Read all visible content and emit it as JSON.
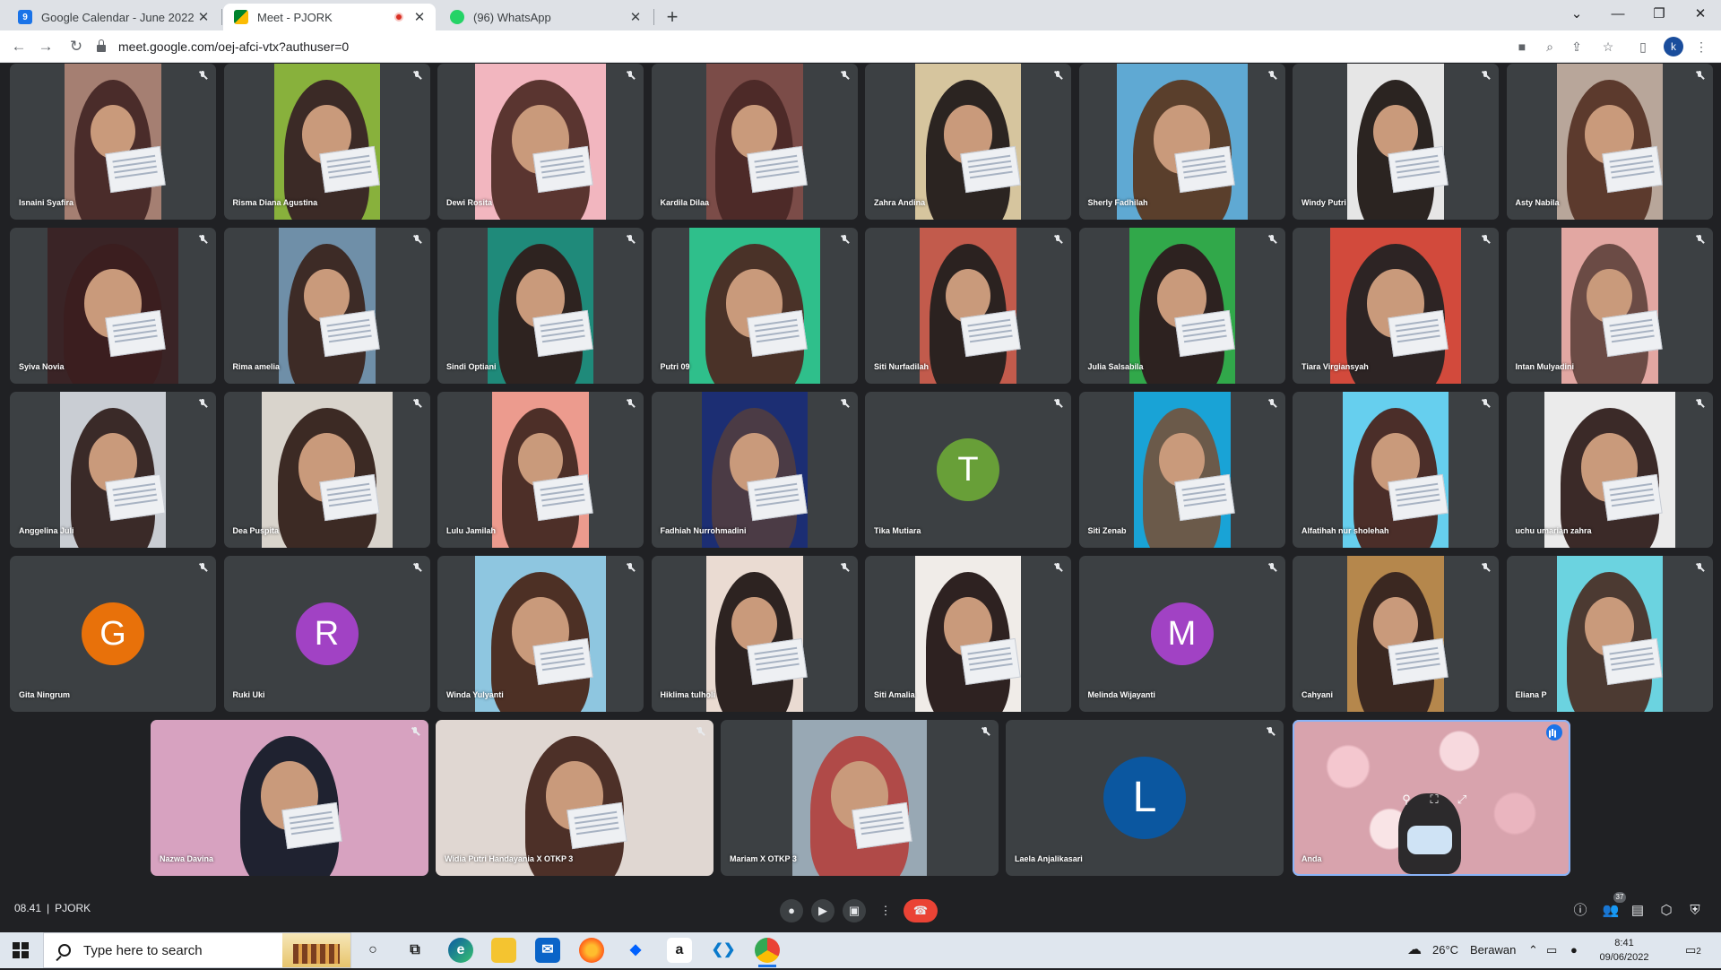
{
  "browser": {
    "tabs": [
      {
        "title": "Google Calendar - June 2022",
        "favicon": "calendar-icon",
        "active": false
      },
      {
        "title": "Meet - PJORK",
        "favicon": "meet-icon",
        "active": true,
        "recording": true
      },
      {
        "title": "(96) WhatsApp",
        "favicon": "whatsapp-icon",
        "active": false
      }
    ],
    "url": "meet.google.com/oej-afci-vtx?authuser=0",
    "profile_initial": "k"
  },
  "participants": [
    {
      "name": "Isnaini Syafira",
      "muted": true
    },
    {
      "name": "Risma Diana Agustina",
      "muted": true
    },
    {
      "name": "Dewi Rosita",
      "muted": true
    },
    {
      "name": "Kardila Dilaa",
      "muted": true
    },
    {
      "name": "Zahra Andina",
      "muted": true
    },
    {
      "name": "Sherly Fadhilah",
      "muted": true
    },
    {
      "name": "Windy Putri",
      "muted": true
    },
    {
      "name": "Asty Nabila",
      "muted": true
    },
    {
      "name": "Syiva Novia",
      "muted": true
    },
    {
      "name": "Rima amelia",
      "muted": true
    },
    {
      "name": "Sindi Optiani",
      "muted": true
    },
    {
      "name": "Putri 09",
      "muted": true
    },
    {
      "name": "Siti Nurfadilah",
      "muted": true
    },
    {
      "name": "Julia Salsabila",
      "muted": true
    },
    {
      "name": "Tiara Virgiansyah",
      "muted": true
    },
    {
      "name": "Intan Mulyadini",
      "muted": true
    },
    {
      "name": "Anggelina Juli",
      "muted": true
    },
    {
      "name": "Dea Puspita",
      "muted": true
    },
    {
      "name": "Lulu Jamilah",
      "muted": true
    },
    {
      "name": "Fadhiah Nurrohmadini",
      "muted": true
    },
    {
      "name": "Tika Mutiara",
      "muted": true,
      "avatar": "T",
      "avatar_color": "#689f38"
    },
    {
      "name": "Siti Zenab",
      "muted": true
    },
    {
      "name": "Alfatihah nur sholehah",
      "muted": true
    },
    {
      "name": "uchu umarian zahra",
      "muted": true
    },
    {
      "name": "Gita Ningrum",
      "muted": true,
      "avatar": "G",
      "avatar_color": "#e8710a"
    },
    {
      "name": "Ruki Uki",
      "muted": true,
      "avatar": "R",
      "avatar_color": "#a142c4"
    },
    {
      "name": "Winda Yulyanti",
      "muted": true
    },
    {
      "name": "Hiklima tulholi",
      "muted": true
    },
    {
      "name": "Siti Amalia",
      "muted": true
    },
    {
      "name": "Melinda Wijayanti",
      "muted": true,
      "avatar": "M",
      "avatar_color": "#a142c4"
    },
    {
      "name": "Cahyani",
      "muted": true
    },
    {
      "name": "Eliana P",
      "muted": true
    },
    {
      "name": "Nazwa Davina",
      "muted": true
    },
    {
      "name": "Widia Putri Handayania X OTKP 3",
      "muted": true
    },
    {
      "name": "Mariam X OTKP 3",
      "muted": true
    },
    {
      "name": "Laela Anjalikasari",
      "muted": true,
      "avatar": "L",
      "avatar_color": "#0b57a0"
    },
    {
      "name": "Anda",
      "muted": false,
      "self": true
    }
  ],
  "meeting": {
    "time": "08.41",
    "separator": "|",
    "code": "PJORK",
    "participant_count": "37"
  },
  "taskbar": {
    "search_placeholder": "Type here to search",
    "weather": "26°C",
    "weather_desc": "Berawan",
    "time": "8:41",
    "date": "09/06/2022",
    "notification_count": "2"
  },
  "colors": {
    "meet_bg": "#202124",
    "tile_bg": "#3c4043",
    "end_call": "#ea4335",
    "active_speaker": "#8ab4f8"
  }
}
